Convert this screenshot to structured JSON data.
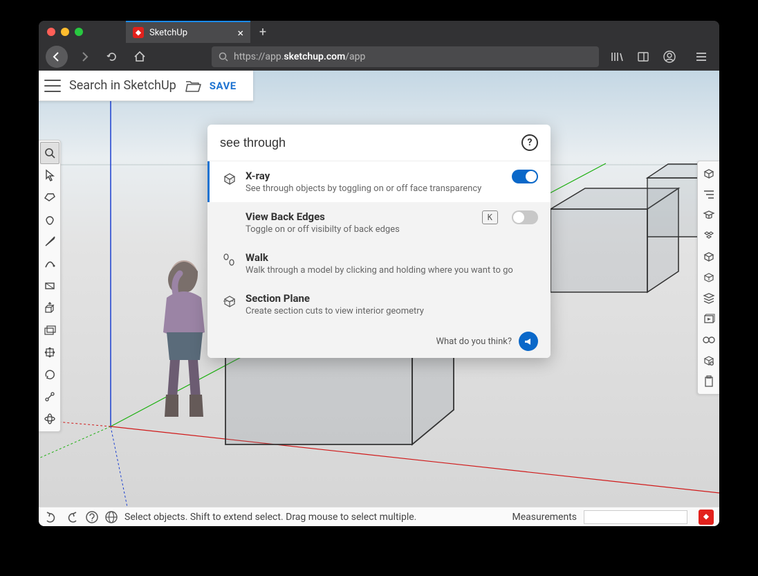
{
  "browser": {
    "tab_title": "SketchUp",
    "url_prefix": "https://app.",
    "url_bold": "sketchup.com",
    "url_suffix": "/app"
  },
  "header": {
    "search_placeholder": "Search in SketchUp",
    "save": "SAVE"
  },
  "search_panel": {
    "query": "see through",
    "help": "?",
    "results": [
      {
        "title": "X-ray",
        "desc": "See through objects by toggling on or off face transparency",
        "shortcut": null,
        "toggle": "on",
        "selected": true,
        "icon": "cube-xray"
      },
      {
        "title": "View Back Edges",
        "desc": "Toggle on or off visibilty of back edges",
        "shortcut": "K",
        "toggle": "off",
        "selected": false,
        "icon": null
      },
      {
        "title": "Walk",
        "desc": "Walk through a model by clicking and holding where you want to go",
        "shortcut": null,
        "toggle": null,
        "selected": false,
        "icon": "footsteps"
      },
      {
        "title": "Section Plane",
        "desc": "Create section cuts to view interior geometry",
        "shortcut": null,
        "toggle": null,
        "selected": false,
        "icon": "section"
      }
    ],
    "footer_text": "What do you think?"
  },
  "statusbar": {
    "hint": "Select objects. Shift to extend select. Drag mouse to select multiple.",
    "measurements_label": "Measurements",
    "measurements_value": ""
  },
  "left_tools": [
    "search",
    "select",
    "eraser",
    "paint",
    "line",
    "arc",
    "rectangle",
    "pushpull",
    "offset",
    "move",
    "rotate",
    "tape",
    "orbit"
  ],
  "right_tools": [
    "info",
    "outliner",
    "instructor",
    "components",
    "materials",
    "layers",
    "scenes",
    "styles",
    "display",
    "clipboard"
  ]
}
